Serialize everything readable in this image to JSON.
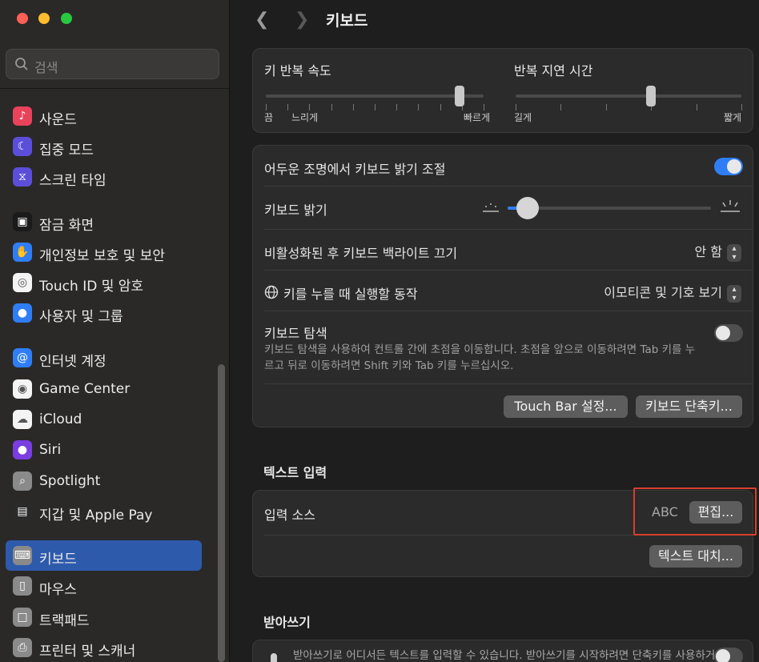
{
  "window": {
    "traffic_colors": [
      "#ff5f57",
      "#febc2e",
      "#28c840"
    ]
  },
  "search": {
    "placeholder": "검색"
  },
  "sidebar": {
    "items": [
      {
        "label": "사운드",
        "icon": "speaker-icon",
        "color": "#e8435a"
      },
      {
        "label": "집중 모드",
        "icon": "moon-icon",
        "color": "#5b4fd9"
      },
      {
        "label": "스크린 타임",
        "icon": "hourglass-icon",
        "color": "#5b4fd9"
      },
      {
        "label": "잠금 화면",
        "icon": "lock-icon",
        "color": "#1a1a1a"
      },
      {
        "label": "개인정보 보호 및 보안",
        "icon": "hand-icon",
        "color": "#2f7ef5"
      },
      {
        "label": "Touch ID 및 암호",
        "icon": "fingerprint-icon",
        "color": "#f4f4f4"
      },
      {
        "label": "사용자 및 그룹",
        "icon": "users-icon",
        "color": "#2f7ef5"
      },
      {
        "label": "인터넷 계정",
        "icon": "at-icon",
        "color": "#2f7ef5"
      },
      {
        "label": "Game Center",
        "icon": "game-center-icon",
        "color": "#f4f4f4"
      },
      {
        "label": "iCloud",
        "icon": "cloud-icon",
        "color": "#f4f4f4"
      },
      {
        "label": "Siri",
        "icon": "siri-icon",
        "color": "#7a3de0"
      },
      {
        "label": "Spotlight",
        "icon": "magnifier-icon",
        "color": "#8a8a8a"
      },
      {
        "label": "지갑 및 Apple Pay",
        "icon": "wallet-icon",
        "color": "#2a2a2a"
      },
      {
        "label": "키보드",
        "icon": "keyboard-icon",
        "color": "#8a8a8a",
        "selected": true
      },
      {
        "label": "마우스",
        "icon": "mouse-icon",
        "color": "#8a8a8a"
      },
      {
        "label": "트랙패드",
        "icon": "trackpad-icon",
        "color": "#8a8a8a"
      },
      {
        "label": "프린터 및 스캐너",
        "icon": "printer-icon",
        "color": "#8a8a8a"
      }
    ]
  },
  "header": {
    "title": "키보드"
  },
  "repeat": {
    "key_repeat_label": "키 반복 속도",
    "key_repeat_min": "끔",
    "key_repeat_slow": "느리게",
    "key_repeat_fast": "빠르게",
    "key_repeat_value": 0.89,
    "delay_label": "반복 지연 시간",
    "delay_long": "길게",
    "delay_short": "짧게",
    "delay_value": 0.6
  },
  "keyboard": {
    "auto_brightness_label": "어두운 조명에서 키보드 밝기 조절",
    "auto_brightness_on": true,
    "brightness_label": "키보드 밝기",
    "brightness_value": 0.1,
    "backlight_off_label": "비활성화된 후 키보드 백라이트 끄기",
    "backlight_off_value": "안 함",
    "globe_label": "키를 누를 때 실행할 동작",
    "globe_value": "이모티콘 및 기호 보기",
    "nav_label": "키보드 탐색",
    "nav_desc": "키보드 탐색을 사용하여 컨트롤 간에 초점을 이동합니다. 초점을 앞으로 이동하려면 Tab 키를 누르고 뒤로 이동하려면 Shift 키와 Tab 키를 누르십시오.",
    "nav_on": false,
    "touchbar_button": "Touch Bar 설정...",
    "shortcuts_button": "키보드 단축키..."
  },
  "text_input": {
    "section_title": "텍스트 입력",
    "input_sources_label": "입력 소스",
    "input_sources_value": "ABC",
    "edit_button": "편집...",
    "text_replace_button": "텍스트 대치..."
  },
  "dictation": {
    "section_title": "받아쓰기",
    "desc": "받아쓰기로 어디서든 텍스트를 입력할 수 있습니다. 받아쓰기를 시작하려면 단축키를 사용하거나"
  },
  "colors": {
    "accent": "#2f7ef5",
    "selection": "#2e5aac",
    "highlight": "#d6402c"
  }
}
